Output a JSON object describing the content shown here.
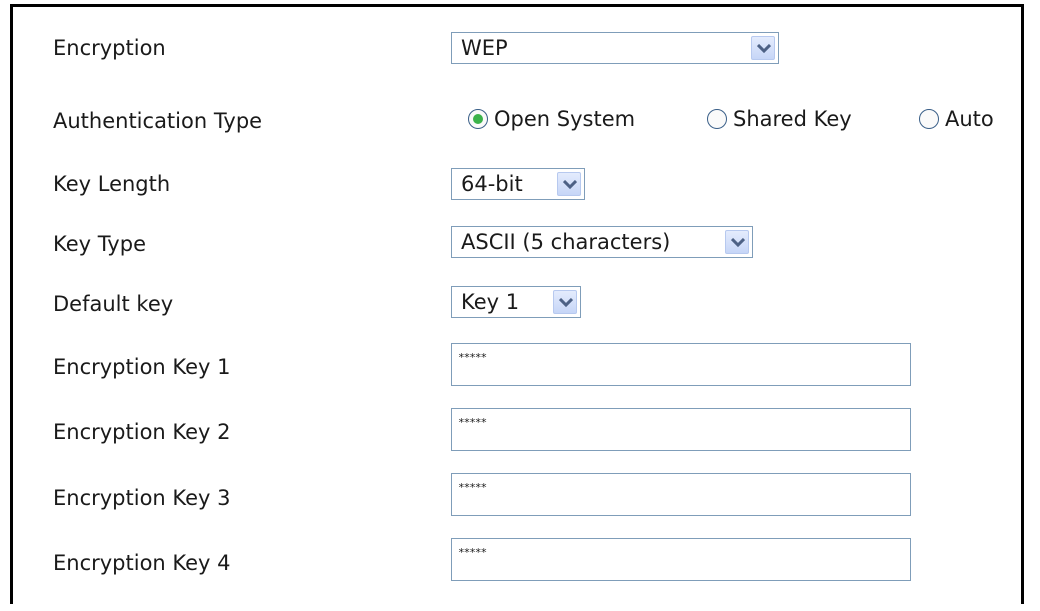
{
  "encryption": {
    "label": "Encryption",
    "selected": "WEP"
  },
  "authentication": {
    "label": "Authentication Type",
    "options": [
      {
        "label": "Open System",
        "checked": true
      },
      {
        "label": "Shared Key",
        "checked": false
      },
      {
        "label": "Auto",
        "checked": false
      }
    ]
  },
  "key_length": {
    "label": "Key Length",
    "selected": "64-bit"
  },
  "key_type": {
    "label": "Key Type",
    "selected": "ASCII (5 characters)"
  },
  "default_key": {
    "label": "Default key",
    "selected": "Key 1"
  },
  "keys": [
    {
      "label": "Encryption Key 1",
      "value": "*****"
    },
    {
      "label": "Encryption Key 2",
      "value": "*****"
    },
    {
      "label": "Encryption Key 3",
      "value": "*****"
    },
    {
      "label": "Encryption Key 4",
      "value": "*****"
    }
  ],
  "colors": {
    "field_border": "#7f9db9",
    "radio_selected": "#3bb24a",
    "dropdown_button": "#c6d6f7"
  },
  "icons": {
    "dropdown": "chevron-down-icon",
    "radio": "radio-icon"
  }
}
